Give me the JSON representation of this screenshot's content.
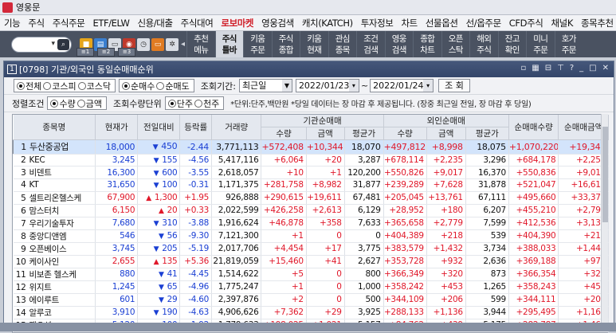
{
  "app": {
    "title": "영웅문"
  },
  "menu": [
    "기능",
    "주식",
    "주식주문",
    "ETF/ELW",
    "신용/대출",
    "주식대여",
    "로보마켓",
    "영웅검색",
    "캐치(KATCH)",
    "투자정보",
    "차트",
    "선물옵션",
    "선/옵주문",
    "CFD주식",
    "채널K",
    "종목추천"
  ],
  "menu_highlight": "로보마켓",
  "toolbar": {
    "items": [
      {
        "top": "추천",
        "bottom": "메뉴"
      },
      {
        "top": "주식",
        "bottom": "틀바",
        "on": true
      },
      {
        "top": "키움",
        "bottom": "주문"
      },
      {
        "top": "주식",
        "bottom": "종합"
      },
      {
        "top": "키움",
        "bottom": "현재"
      },
      {
        "top": "관심",
        "bottom": "종목"
      },
      {
        "top": "조건",
        "bottom": "검색"
      },
      {
        "top": "영웅",
        "bottom": "검색"
      },
      {
        "top": "종합",
        "bottom": "차트"
      },
      {
        "top": "오픈",
        "bottom": "스탁"
      },
      {
        "top": "해외",
        "bottom": "주식"
      },
      {
        "top": "잔고",
        "bottom": "확인"
      },
      {
        "top": "미니",
        "bottom": "주문"
      },
      {
        "top": "호가",
        "bottom": "주문"
      }
    ]
  },
  "window": {
    "num": "1",
    "title": "[0798] 기관/외국인 동일순매매순위"
  },
  "filters": {
    "market": [
      "전체",
      "코스피",
      "코스닥"
    ],
    "market_selected": 0,
    "dir": [
      "순매수",
      "순매도"
    ],
    "dir_selected": 0,
    "period_label": "조회기간:",
    "period_value": "최근일",
    "date_from": "2022/01/23",
    "date_to": "2022/01/24",
    "tilde": "~",
    "query_btn": "조 회",
    "cond_label": "정렬조건",
    "cond": [
      "수량",
      "금액"
    ],
    "cond_selected": 0,
    "unit_label": "조회수량단위",
    "unit": [
      "단주",
      "천주"
    ],
    "unit_selected": 0,
    "note": "*단위:단주,백만원 *당일 데이터는 장 마감 후 제공됩니다. (장중 최근일 전일, 장 마감 후 당일)"
  },
  "table": {
    "headers": {
      "name": "종목명",
      "price": "현재가",
      "change": "전일대비",
      "rate": "등락률",
      "volume": "거래량",
      "inst": "기관순매매",
      "frgn": "외인순매매",
      "qty": "수량",
      "amt": "금액",
      "avg": "평균가",
      "net_qty": "순매매수량",
      "net_amt": "순매매금액"
    },
    "rows": [
      {
        "no": "1",
        "name": "두산중공업",
        "price": "18,000",
        "sign": "▼",
        "chg": "450",
        "rate": "-2.44",
        "vol": "3,771,113",
        "iq": "+572,408",
        "ia": "+10,344",
        "ip": "18,070",
        "fq": "+497,812",
        "fa": "+8,998",
        "fp": "18,075",
        "nq": "+1,070,220",
        "na": "+19,342",
        "dir": "dn",
        "sel": true
      },
      {
        "no": "2",
        "name": "KEC",
        "price": "3,245",
        "sign": "▼",
        "chg": "155",
        "rate": "-4.56",
        "vol": "5,417,116",
        "iq": "+6,064",
        "ia": "+20",
        "ip": "3,287",
        "fq": "+678,114",
        "fa": "+2,235",
        "fp": "3,296",
        "nq": "+684,178",
        "na": "+2,255",
        "dir": "dn"
      },
      {
        "no": "3",
        "name": "비덴트",
        "price": "16,300",
        "sign": "▼",
        "chg": "600",
        "rate": "-3.55",
        "vol": "2,618,057",
        "iq": "+10",
        "ia": "+1",
        "ip": "120,200",
        "fq": "+550,826",
        "fa": "+9,017",
        "fp": "16,370",
        "nq": "+550,836",
        "na": "+9,018",
        "dir": "dn"
      },
      {
        "no": "4",
        "name": "KT",
        "price": "31,650",
        "sign": "▼",
        "chg": "100",
        "rate": "-0.31",
        "vol": "1,171,375",
        "iq": "+281,758",
        "ia": "+8,982",
        "ip": "31,877",
        "fq": "+239,289",
        "fa": "+7,628",
        "fp": "31,878",
        "nq": "+521,047",
        "na": "+16,610",
        "dir": "dn"
      },
      {
        "no": "5",
        "name": "셀트리온헬스케",
        "price": "67,900",
        "sign": "▲",
        "chg": "1,300",
        "rate": "+1.95",
        "vol": "926,888",
        "iq": "+290,615",
        "ia": "+19,611",
        "ip": "67,481",
        "fq": "+205,045",
        "fa": "+13,761",
        "fp": "67,111",
        "nq": "+495,660",
        "na": "+33,372",
        "dir": "up"
      },
      {
        "no": "6",
        "name": "맘스터치",
        "price": "6,150",
        "sign": "▲",
        "chg": "20",
        "rate": "+0.33",
        "vol": "2,022,599",
        "iq": "+426,258",
        "ia": "+2,613",
        "ip": "6,129",
        "fq": "+28,952",
        "fa": "+180",
        "fp": "6,207",
        "nq": "+455,210",
        "na": "+2,792",
        "dir": "up"
      },
      {
        "no": "7",
        "name": "우리기술투자",
        "price": "7,680",
        "sign": "▼",
        "chg": "310",
        "rate": "-3.88",
        "vol": "1,916,624",
        "iq": "+46,878",
        "ia": "+358",
        "ip": "7,633",
        "fq": "+365,658",
        "fa": "+2,779",
        "fp": "7,599",
        "nq": "+412,536",
        "na": "+3,136",
        "dir": "dn"
      },
      {
        "no": "8",
        "name": "중앙디앤엠",
        "price": "546",
        "sign": "▼",
        "chg": "56",
        "rate": "-9.30",
        "vol": "7,121,300",
        "iq": "+1",
        "ia": "0",
        "ip": "0",
        "fq": "+404,389",
        "fa": "+218",
        "fp": "539",
        "nq": "+404,390",
        "na": "+218",
        "dir": "dn"
      },
      {
        "no": "9",
        "name": "오픈베이스",
        "price": "3,745",
        "sign": "▼",
        "chg": "205",
        "rate": "-5.19",
        "vol": "2,017,706",
        "iq": "+4,454",
        "ia": "+17",
        "ip": "3,775",
        "fq": "+383,579",
        "fa": "+1,432",
        "fp": "3,734",
        "nq": "+388,033",
        "na": "+1,449",
        "dir": "dn"
      },
      {
        "no": "10",
        "name": "케이사인",
        "price": "2,655",
        "sign": "▲",
        "chg": "135",
        "rate": "+5.36",
        "vol": "21,819,059",
        "iq": "+15,460",
        "ia": "+41",
        "ip": "2,627",
        "fq": "+353,728",
        "fa": "+932",
        "fp": "2,636",
        "nq": "+369,188",
        "na": "+973",
        "dir": "up"
      },
      {
        "no": "11",
        "name": "비보존 헬스케",
        "price": "880",
        "sign": "▼",
        "chg": "41",
        "rate": "-4.45",
        "vol": "1,514,622",
        "iq": "+5",
        "ia": "0",
        "ip": "800",
        "fq": "+366,349",
        "fa": "+320",
        "fp": "873",
        "nq": "+366,354",
        "na": "+320",
        "dir": "dn"
      },
      {
        "no": "12",
        "name": "위지트",
        "price": "1,245",
        "sign": "▼",
        "chg": "65",
        "rate": "-4.96",
        "vol": "1,775,247",
        "iq": "+1",
        "ia": "0",
        "ip": "1,000",
        "fq": "+358,242",
        "fa": "+453",
        "fp": "1,265",
        "nq": "+358,243",
        "na": "+453",
        "dir": "dn"
      },
      {
        "no": "13",
        "name": "에이루트",
        "price": "601",
        "sign": "▼",
        "chg": "29",
        "rate": "-4.60",
        "vol": "2,397,876",
        "iq": "+2",
        "ia": "0",
        "ip": "500",
        "fq": "+344,109",
        "fa": "+206",
        "fp": "599",
        "nq": "+344,111",
        "na": "+206",
        "dir": "dn"
      },
      {
        "no": "14",
        "name": "알루코",
        "price": "3,910",
        "sign": "▼",
        "chg": "190",
        "rate": "-4.63",
        "vol": "4,906,626",
        "iq": "+7,362",
        "ia": "+29",
        "ip": "3,925",
        "fq": "+288,133",
        "fa": "+1,136",
        "fp": "3,944",
        "nq": "+295,495",
        "na": "+1,165",
        "dir": "dn"
      },
      {
        "no": "15",
        "name": "팬오션",
        "price": "5,120",
        "sign": "▼",
        "chg": "100",
        "rate": "-1.92",
        "vol": "1,779,633",
        "iq": "+198,025",
        "ia": "+1,021",
        "ip": "5,157",
        "fq": "+84,762",
        "fa": "+439",
        "fp": "5,175",
        "nq": "+282,787",
        "na": "+1,460",
        "dir": "dn"
      }
    ]
  }
}
